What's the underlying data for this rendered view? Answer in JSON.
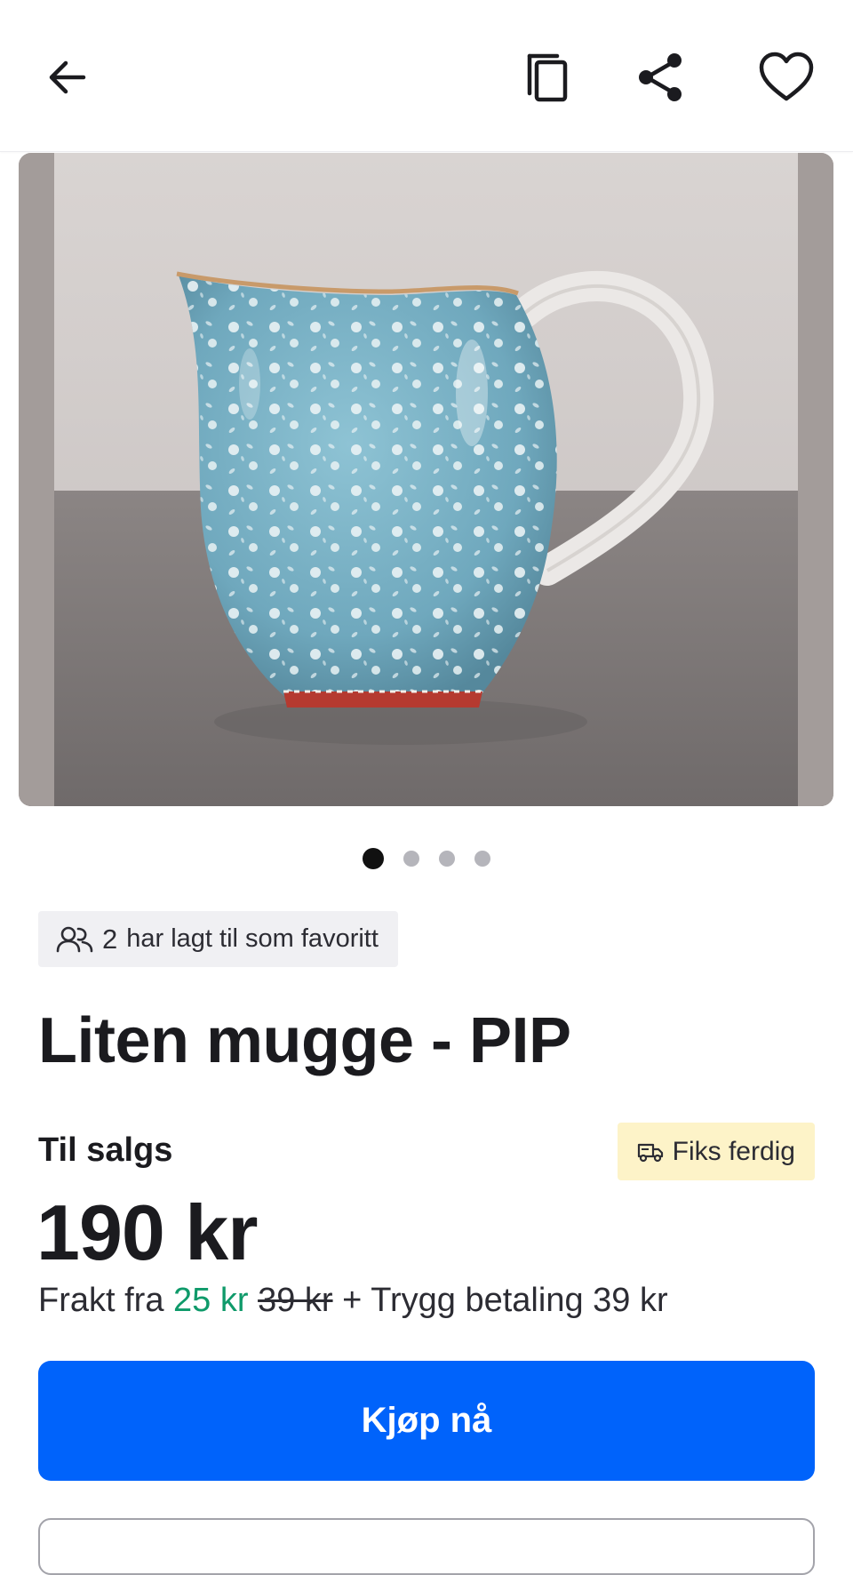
{
  "topbar": {
    "back_icon": "arrow-left-icon",
    "copy_icon": "copy-icon",
    "share_icon": "share-icon",
    "favorite_icon": "heart-outline-icon"
  },
  "gallery": {
    "image_alt": "",
    "total_images": 4,
    "active_index": 0
  },
  "listing": {
    "favorites_icon": "users-icon",
    "favorites_count": "2",
    "favorites_text": "har lagt til som favoritt",
    "title": "Liten mugge - PIP",
    "status": "Til salgs",
    "shipping_badge_icon": "truck-icon",
    "shipping_badge": "Fiks ferdig",
    "price": "190 kr",
    "freight_prefix": "Frakt fra",
    "freight_price": "25 kr",
    "freight_old_price": "39 kr",
    "freight_suffix": "+ Trygg betaling 39 kr"
  },
  "actions": {
    "buy_label": "Kjøp nå"
  },
  "colors": {
    "primary": "#0063fb",
    "discount_green": "#0f9a6a",
    "badge_yellow": "#fdf3c8",
    "badge_gray": "#f0f0f3"
  }
}
